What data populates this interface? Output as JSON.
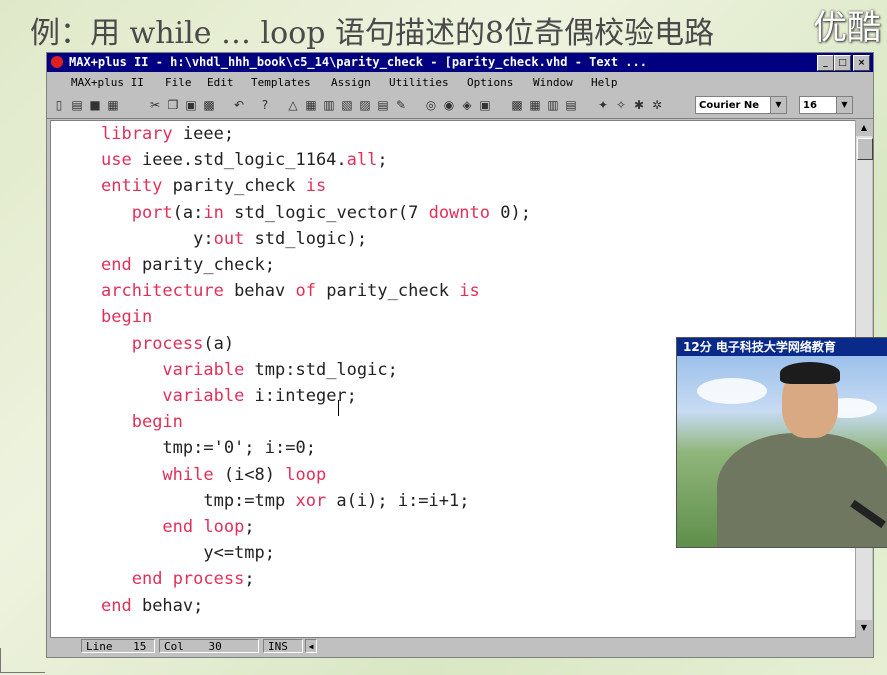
{
  "slide": {
    "title": "例：用 while … loop 语句描述的8位奇偶校验电路",
    "logo": "优酷"
  },
  "window": {
    "title": "MAX+plus II - h:\\vhdl_hhh_book\\c5_14\\parity_check - [parity_check.vhd - Text ...",
    "min_label": "_",
    "max_label": "□",
    "close_label": "×"
  },
  "menu": [
    "MAX+plus II",
    "File",
    "Edit",
    "Templates",
    "Assign",
    "Utilities",
    "Options",
    "Window",
    "Help"
  ],
  "toolbar": {
    "font_combo": "Courier Ne",
    "size_combo": "16"
  },
  "code": [
    "library ieee;",
    "use ieee.std_logic_1164.all;",
    "entity parity_check is",
    "   port(a:in std_logic_vector(7 downto 0);",
    "         y:out std_logic);",
    "end parity_check;",
    "architecture behav of parity_check is",
    "begin",
    "   process(a)",
    "      variable tmp:std_logic;",
    "      variable i:integer;",
    "   begin",
    "      tmp:='0'; i:=0;",
    "      while (i<8) loop",
    "          tmp:=tmp xor a(i); i:=i+1;",
    "      end loop;",
    "          y<=tmp;",
    "   end process;",
    "end behav;"
  ],
  "status": {
    "line_label": "Line",
    "line_value": "15",
    "col_label": "Col",
    "col_value": "30",
    "mode": "INS"
  },
  "video": {
    "caption": "12分 电子科技大学网络教育"
  },
  "colors": {
    "keyword": "#e0305a",
    "titlebar": "#000080"
  }
}
